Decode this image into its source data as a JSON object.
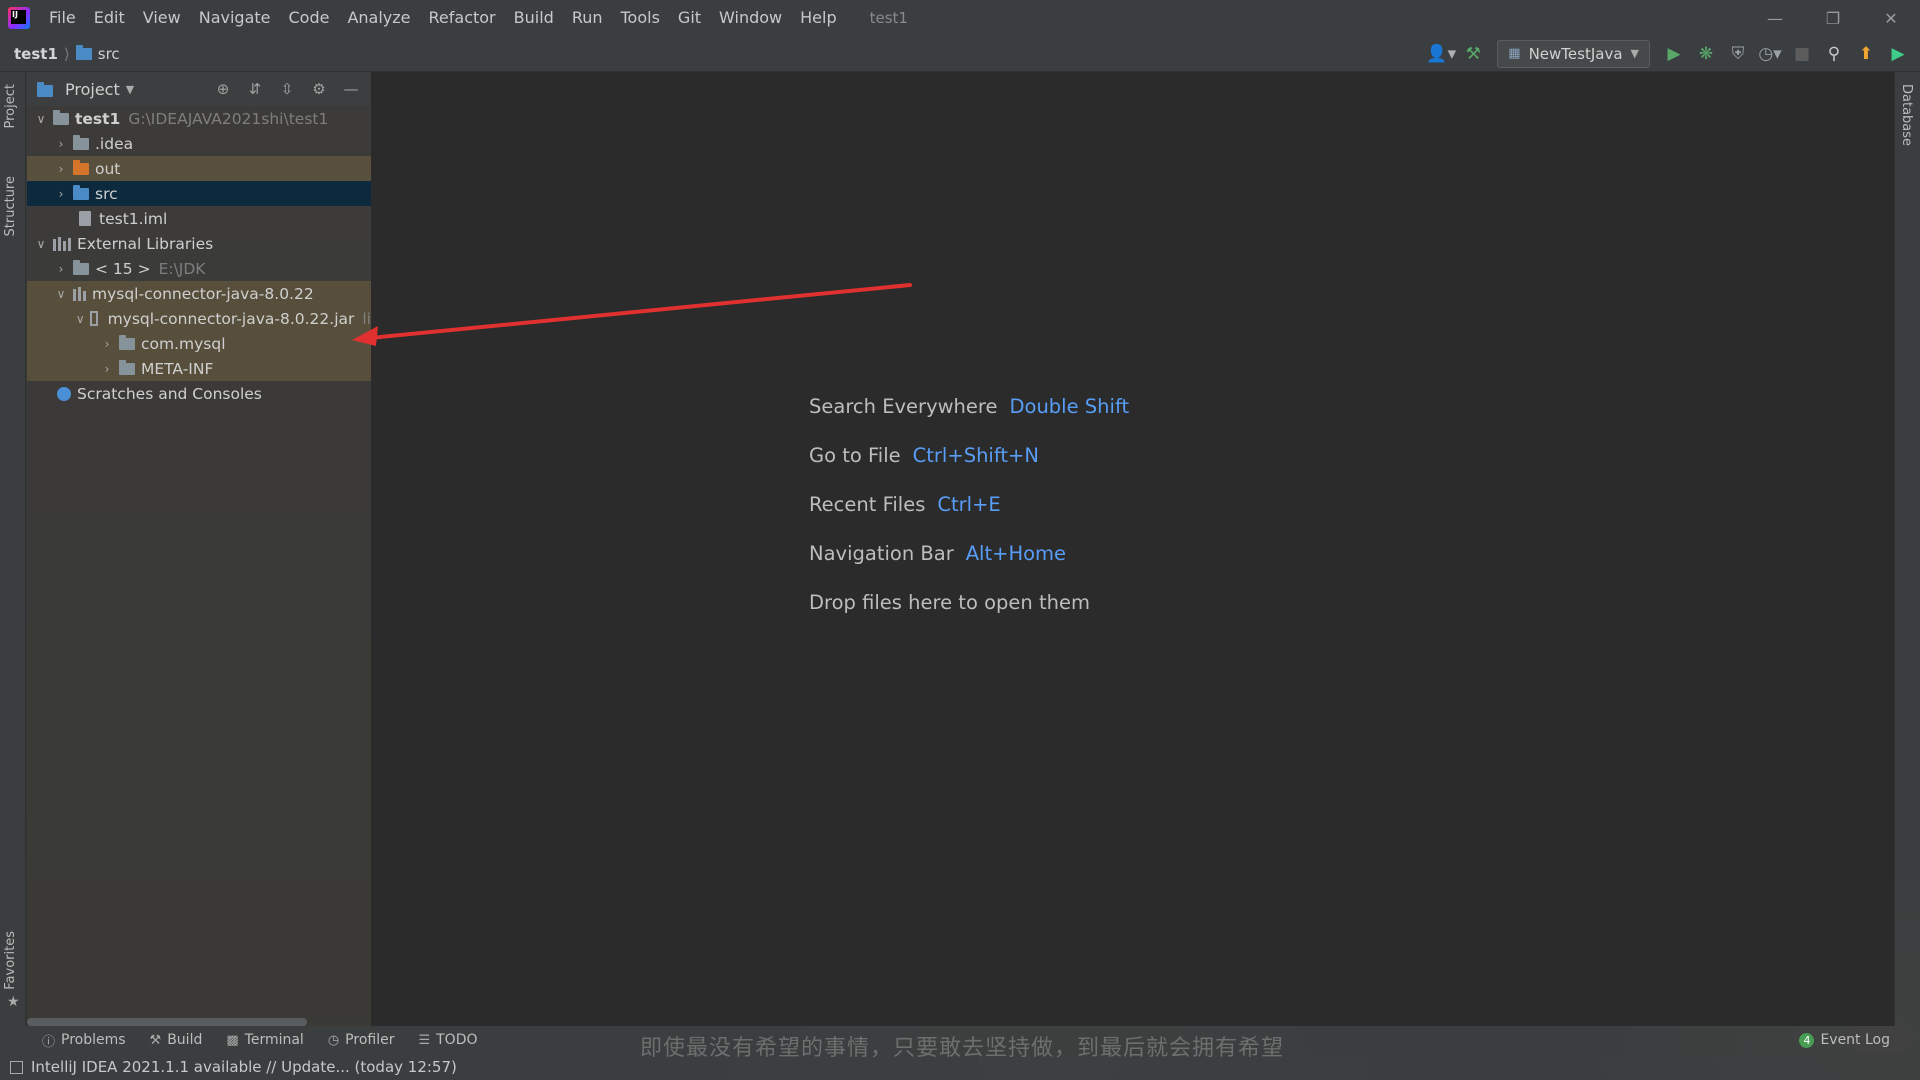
{
  "menu": {
    "items": [
      "File",
      "Edit",
      "View",
      "Navigate",
      "Code",
      "Analyze",
      "Refactor",
      "Build",
      "Run",
      "Tools",
      "Git",
      "Window",
      "Help"
    ],
    "window_title": "test1"
  },
  "navbar": {
    "project": "test1",
    "folder": "src",
    "run_config": "NewTestJava"
  },
  "left_stripe": {
    "project_tab": "Project",
    "structure_tab": "Structure",
    "favorites_tab": "Favorites"
  },
  "right_stripe": {
    "database_tab": "Database"
  },
  "project_panel": {
    "title": "Project",
    "tree": [
      {
        "label": "test1",
        "hint": "G:\\IDEAJAVA2021shi\\test1"
      },
      {
        "label": ".idea"
      },
      {
        "label": "out"
      },
      {
        "label": "src"
      },
      {
        "label": "test1.iml"
      },
      {
        "label": "External Libraries"
      },
      {
        "label": "< 15 >",
        "hint": "E:\\JDK"
      },
      {
        "label": "mysql-connector-java-8.0.22"
      },
      {
        "label": "mysql-connector-java-8.0.22.jar",
        "hint": "li"
      },
      {
        "label": "com.mysql"
      },
      {
        "label": "META-INF"
      },
      {
        "label": "Scratches and Consoles"
      }
    ]
  },
  "welcome": {
    "lines": [
      {
        "text": "Search Everywhere",
        "key": "Double Shift"
      },
      {
        "text": "Go to File",
        "key": "Ctrl+Shift+N"
      },
      {
        "text": "Recent Files",
        "key": "Ctrl+E"
      },
      {
        "text": "Navigation Bar",
        "key": "Alt+Home"
      },
      {
        "text": "Drop files here to open them",
        "key": ""
      }
    ]
  },
  "bottom_tabs": {
    "problems": "Problems",
    "build": "Build",
    "terminal": "Terminal",
    "profiler": "Profiler",
    "todo": "TODO",
    "event_log": "Event Log",
    "event_count": "4"
  },
  "overlay_caption": "即使最没有希望的事情，只要敢去坚持做，到最后就会拥有希望",
  "status": {
    "message": "IntelliJ IDEA 2021.1.1 available // Update... (today 12:57)"
  },
  "colors": {
    "accent_key": "#589df6",
    "selection": "#0d293e",
    "highlight_rows": "#6b5e3f",
    "annotation_arrow": "#e03030"
  }
}
